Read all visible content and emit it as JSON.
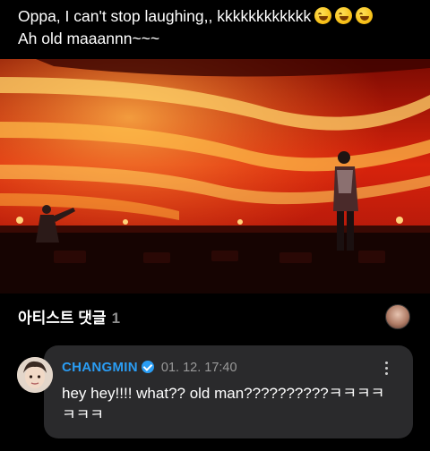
{
  "post": {
    "line1": "Oppa, I can't stop laughing,, kkkkkkkkkkkk",
    "line2": "Ah old maaannn~~~",
    "emoji": "rolling-on-floor-laughing"
  },
  "video": {
    "description_colors": {
      "stage": "#e0240e",
      "glow": "#ff9a2a",
      "floor": "#120302"
    }
  },
  "artist_comments": {
    "title": "아티스트 댓글",
    "count": "1"
  },
  "comment": {
    "author": "CHANGMIN",
    "timestamp": "01. 12. 17:40",
    "text": "hey hey!!!! what?? old man??????????ㅋㅋㅋㅋㅋㅋㅋ",
    "author_color": "#2a9df4"
  },
  "colors": {
    "background": "#000000",
    "card": "#2a2a2c",
    "accent": "#2a9df4",
    "muted": "#8e8e8e"
  }
}
